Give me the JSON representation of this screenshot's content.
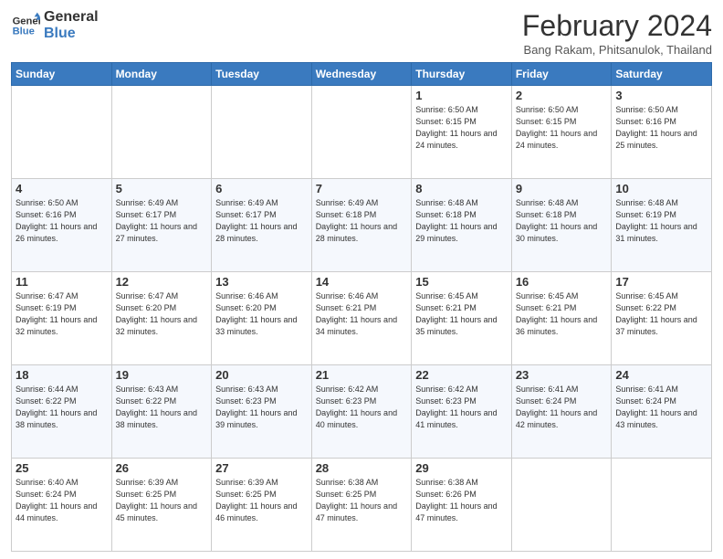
{
  "header": {
    "logo_line1": "General",
    "logo_line2": "Blue",
    "month_title": "February 2024",
    "location": "Bang Rakam, Phitsanulok, Thailand"
  },
  "weekdays": [
    "Sunday",
    "Monday",
    "Tuesday",
    "Wednesday",
    "Thursday",
    "Friday",
    "Saturday"
  ],
  "weeks": [
    [
      {
        "day": "",
        "info": ""
      },
      {
        "day": "",
        "info": ""
      },
      {
        "day": "",
        "info": ""
      },
      {
        "day": "",
        "info": ""
      },
      {
        "day": "1",
        "info": "Sunrise: 6:50 AM\nSunset: 6:15 PM\nDaylight: 11 hours\nand 24 minutes."
      },
      {
        "day": "2",
        "info": "Sunrise: 6:50 AM\nSunset: 6:15 PM\nDaylight: 11 hours\nand 24 minutes."
      },
      {
        "day": "3",
        "info": "Sunrise: 6:50 AM\nSunset: 6:16 PM\nDaylight: 11 hours\nand 25 minutes."
      }
    ],
    [
      {
        "day": "4",
        "info": "Sunrise: 6:50 AM\nSunset: 6:16 PM\nDaylight: 11 hours\nand 26 minutes."
      },
      {
        "day": "5",
        "info": "Sunrise: 6:49 AM\nSunset: 6:17 PM\nDaylight: 11 hours\nand 27 minutes."
      },
      {
        "day": "6",
        "info": "Sunrise: 6:49 AM\nSunset: 6:17 PM\nDaylight: 11 hours\nand 28 minutes."
      },
      {
        "day": "7",
        "info": "Sunrise: 6:49 AM\nSunset: 6:18 PM\nDaylight: 11 hours\nand 28 minutes."
      },
      {
        "day": "8",
        "info": "Sunrise: 6:48 AM\nSunset: 6:18 PM\nDaylight: 11 hours\nand 29 minutes."
      },
      {
        "day": "9",
        "info": "Sunrise: 6:48 AM\nSunset: 6:18 PM\nDaylight: 11 hours\nand 30 minutes."
      },
      {
        "day": "10",
        "info": "Sunrise: 6:48 AM\nSunset: 6:19 PM\nDaylight: 11 hours\nand 31 minutes."
      }
    ],
    [
      {
        "day": "11",
        "info": "Sunrise: 6:47 AM\nSunset: 6:19 PM\nDaylight: 11 hours\nand 32 minutes."
      },
      {
        "day": "12",
        "info": "Sunrise: 6:47 AM\nSunset: 6:20 PM\nDaylight: 11 hours\nand 32 minutes."
      },
      {
        "day": "13",
        "info": "Sunrise: 6:46 AM\nSunset: 6:20 PM\nDaylight: 11 hours\nand 33 minutes."
      },
      {
        "day": "14",
        "info": "Sunrise: 6:46 AM\nSunset: 6:21 PM\nDaylight: 11 hours\nand 34 minutes."
      },
      {
        "day": "15",
        "info": "Sunrise: 6:45 AM\nSunset: 6:21 PM\nDaylight: 11 hours\nand 35 minutes."
      },
      {
        "day": "16",
        "info": "Sunrise: 6:45 AM\nSunset: 6:21 PM\nDaylight: 11 hours\nand 36 minutes."
      },
      {
        "day": "17",
        "info": "Sunrise: 6:45 AM\nSunset: 6:22 PM\nDaylight: 11 hours\nand 37 minutes."
      }
    ],
    [
      {
        "day": "18",
        "info": "Sunrise: 6:44 AM\nSunset: 6:22 PM\nDaylight: 11 hours\nand 38 minutes."
      },
      {
        "day": "19",
        "info": "Sunrise: 6:43 AM\nSunset: 6:22 PM\nDaylight: 11 hours\nand 38 minutes."
      },
      {
        "day": "20",
        "info": "Sunrise: 6:43 AM\nSunset: 6:23 PM\nDaylight: 11 hours\nand 39 minutes."
      },
      {
        "day": "21",
        "info": "Sunrise: 6:42 AM\nSunset: 6:23 PM\nDaylight: 11 hours\nand 40 minutes."
      },
      {
        "day": "22",
        "info": "Sunrise: 6:42 AM\nSunset: 6:23 PM\nDaylight: 11 hours\nand 41 minutes."
      },
      {
        "day": "23",
        "info": "Sunrise: 6:41 AM\nSunset: 6:24 PM\nDaylight: 11 hours\nand 42 minutes."
      },
      {
        "day": "24",
        "info": "Sunrise: 6:41 AM\nSunset: 6:24 PM\nDaylight: 11 hours\nand 43 minutes."
      }
    ],
    [
      {
        "day": "25",
        "info": "Sunrise: 6:40 AM\nSunset: 6:24 PM\nDaylight: 11 hours\nand 44 minutes."
      },
      {
        "day": "26",
        "info": "Sunrise: 6:39 AM\nSunset: 6:25 PM\nDaylight: 11 hours\nand 45 minutes."
      },
      {
        "day": "27",
        "info": "Sunrise: 6:39 AM\nSunset: 6:25 PM\nDaylight: 11 hours\nand 46 minutes."
      },
      {
        "day": "28",
        "info": "Sunrise: 6:38 AM\nSunset: 6:25 PM\nDaylight: 11 hours\nand 47 minutes."
      },
      {
        "day": "29",
        "info": "Sunrise: 6:38 AM\nSunset: 6:26 PM\nDaylight: 11 hours\nand 47 minutes."
      },
      {
        "day": "",
        "info": ""
      },
      {
        "day": "",
        "info": ""
      }
    ]
  ]
}
